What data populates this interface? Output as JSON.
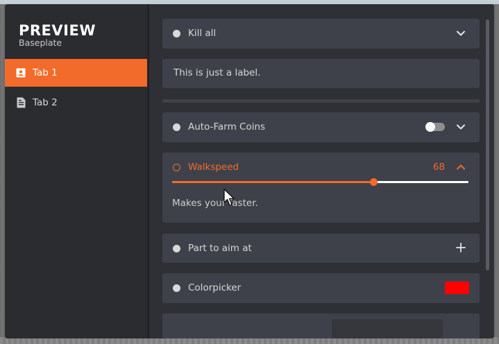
{
  "app": {
    "title": "PREVIEW",
    "subtitle": "Baseplate"
  },
  "sidebar": {
    "tabs": [
      {
        "label": "Tab 1",
        "icon": "contact-card-icon",
        "active": true
      },
      {
        "label": "Tab 2",
        "icon": "document-icon",
        "active": false
      }
    ]
  },
  "main": {
    "dropdown_kill_all": {
      "label": "Kill all",
      "icon": "chevron-down-icon"
    },
    "label_element": {
      "text": "This is just a label."
    },
    "toggle_autofarm": {
      "label": "Auto-Farm Coins",
      "state": "off",
      "icon": "chevron-down-icon"
    },
    "slider_walkspeed": {
      "label": "Walkspeed",
      "value": "68",
      "fill_fraction": 0.68,
      "description": "Makes your faster.",
      "icon": "chevron-up-icon"
    },
    "keybind_part": {
      "label": "Part to aim at",
      "icon": "plus-icon"
    },
    "colorpicker": {
      "label": "Colorpicker",
      "color": "#ff0000"
    }
  },
  "colors": {
    "accent": "#f26b2a",
    "window_bg": "#2b2c30",
    "card_bg": "#3f414a"
  }
}
